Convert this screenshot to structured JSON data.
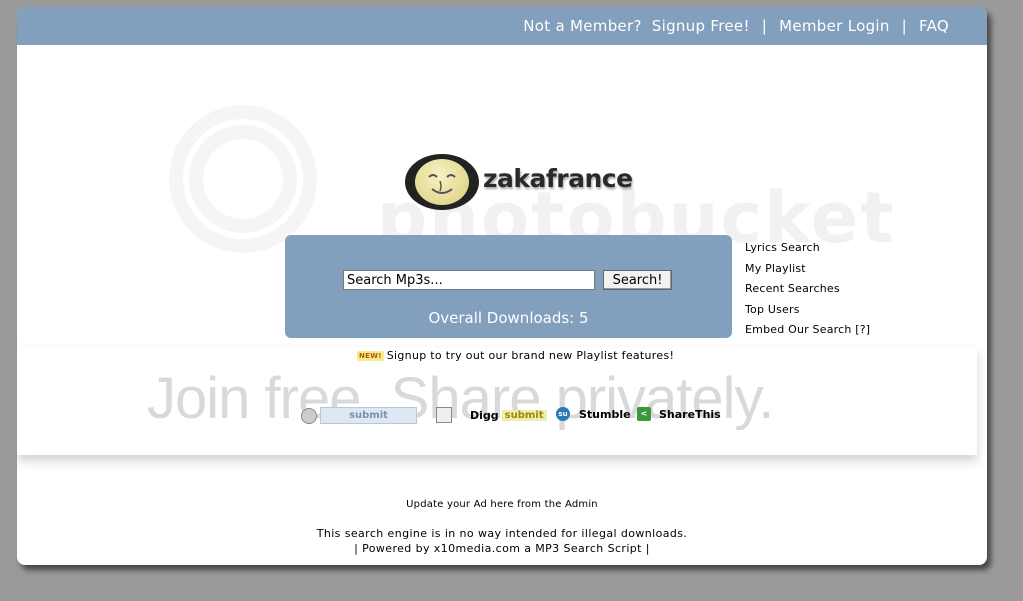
{
  "topbar": {
    "not_member": "Not a Member?",
    "signup": "Signup Free!",
    "sep1": "|",
    "login": "Member Login",
    "sep2": "|",
    "faq": "FAQ"
  },
  "watermark": {
    "top": "photobucket",
    "bottom": "Join free. Share privately."
  },
  "logo": {
    "text": "zakafrance",
    "icon": "smiley-face-icon"
  },
  "search": {
    "placeholder": "Search Mp3s...",
    "button": "Search!",
    "downloads": "Overall Downloads: 5"
  },
  "side_links": [
    "Lyrics Search",
    "My Playlist",
    "Recent Searches",
    "Top Users",
    "Embed Our Search [?]"
  ],
  "notice": {
    "badge": "NEW!",
    "text": "Signup to try out our brand new Playlist features!"
  },
  "social": {
    "reddit_submit": "submit",
    "digg": "Digg",
    "digg_submit": "submit",
    "stumble_icon_label": "su",
    "stumble": "Stumble",
    "sharethis": "ShareThis"
  },
  "footer": {
    "ad": "Update your Ad here from the Admin",
    "disclaimer": "This search engine is in no way intended for illegal downloads.",
    "powered": "| Powered by x10media.com a MP3 Search Script |"
  },
  "colors": {
    "accent": "#829fbd",
    "page_bg": "#9a9a9a"
  }
}
